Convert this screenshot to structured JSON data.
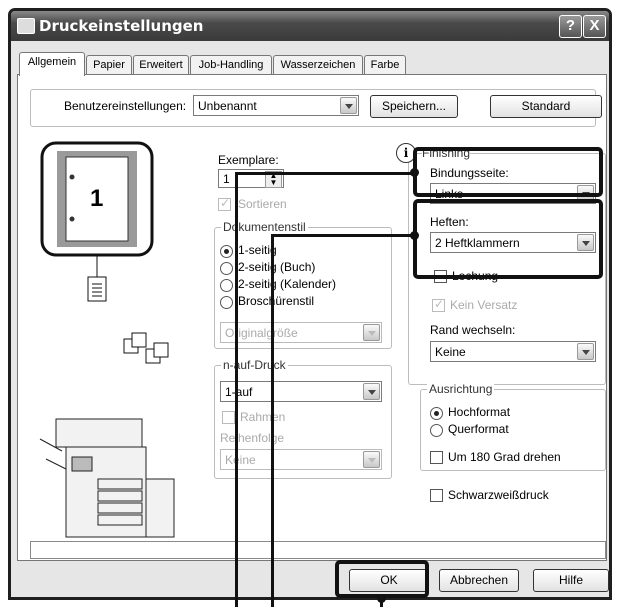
{
  "window": {
    "title": "Druckeinstellungen",
    "help_button": "?",
    "close_button": "X"
  },
  "tabs": [
    {
      "label": "Allgemein",
      "active": true
    },
    {
      "label": "Papier"
    },
    {
      "label": "Erweitert"
    },
    {
      "label": "Job-Handling"
    },
    {
      "label": "Wasserzeichen"
    },
    {
      "label": "Farbe"
    }
  ],
  "user_settings": {
    "label": "Benutzereinstellungen:",
    "value": "Unbenannt",
    "save_button": "Speichern...",
    "default_button": "Standard"
  },
  "preview": {
    "page_number": "1"
  },
  "copies": {
    "label": "Exemplare:",
    "value": "1"
  },
  "collate": {
    "label": "Sortieren",
    "checked": true,
    "disabled": true
  },
  "document_style": {
    "title": "Dokumentenstil",
    "options": [
      "1-seitig",
      "2-seitig (Buch)",
      "2-seitig (Kalender)",
      "Broschürenstil"
    ],
    "selected": 0,
    "original_size": "Originalgröße"
  },
  "n_up": {
    "title": "n-auf-Druck",
    "value": "1-auf",
    "border_label": "Rahmen",
    "order_label": "Reihenfolge",
    "order_value": "Keine"
  },
  "finishing": {
    "title": "Finishing",
    "binding_label": "Bindungsseite:",
    "binding_value": "Links",
    "staple_label": "Heften:",
    "staple_value": "2 Heftklammern",
    "punch_label": "Lochung",
    "no_offset_label": "Kein Versatz",
    "margin_shift_label": "Rand wechseln:",
    "margin_shift_value": "Keine"
  },
  "orientation": {
    "title": "Ausrichtung",
    "portrait": "Hochformat",
    "landscape": "Querformat",
    "rotate_label": "Um 180 Grad drehen"
  },
  "bw_print": {
    "label": "Schwarzweißdruck"
  },
  "footer": {
    "ok": "OK",
    "cancel": "Abbrechen",
    "help": "Hilfe"
  }
}
